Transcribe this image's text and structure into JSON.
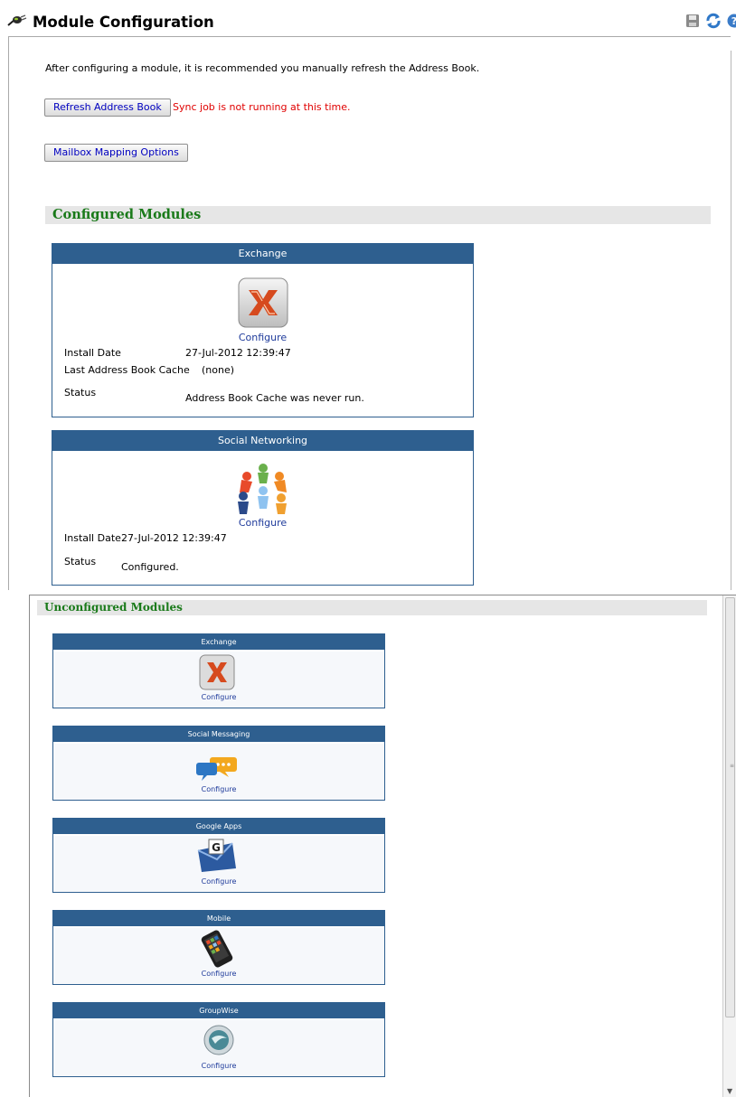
{
  "top": {
    "title": "Module Configuration",
    "intro_text": "After configuring a module, it is recommended you manually refresh the Address Book.",
    "refresh_button": "Refresh Address Book",
    "sync_status": "Sync job is not running at this time.",
    "mapping_button": "Mailbox Mapping Options",
    "configured_header": "Configured Modules",
    "configured_modules": [
      {
        "name": "Exchange",
        "configure_label": "Configure",
        "install_date_label": "Install Date",
        "install_date_value": "27-Jul-2012 12:39:47",
        "cache_label": "Last Address Book Cache",
        "cache_value": "(none)",
        "status_label": "Status",
        "status_value": "Address Book Cache was never run."
      },
      {
        "name": "Social Networking",
        "configure_label": "Configure",
        "install_date_label": "Install Date",
        "install_date_value": "27-Jul-2012 12:39:47",
        "status_label": "Status",
        "status_value": "Configured."
      }
    ]
  },
  "bottom": {
    "unconfigured_header": "Unconfigured Modules",
    "modules": [
      {
        "name": "Exchange",
        "configure_label": "Configure",
        "icon": "exchange-icon"
      },
      {
        "name": "Social Messaging",
        "configure_label": "Configure",
        "icon": "chat-bubbles-icon"
      },
      {
        "name": "Google Apps",
        "configure_label": "Configure",
        "icon": "google-mail-icon"
      },
      {
        "name": "Mobile",
        "configure_label": "Configure",
        "icon": "mobile-phone-icon"
      },
      {
        "name": "GroupWise",
        "configure_label": "Configure",
        "icon": "groupwise-icon"
      }
    ]
  },
  "colors": {
    "panel_header": "#2e5f8f",
    "section_title": "#1a7a1a",
    "status_error": "#e00000",
    "link": "#1f3b9b"
  }
}
